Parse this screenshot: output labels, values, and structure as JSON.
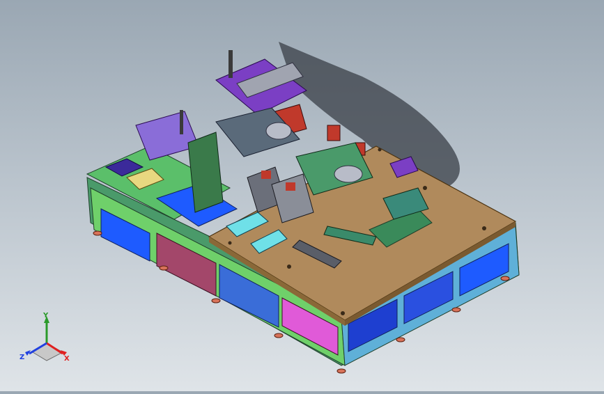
{
  "viewport": {
    "colors": {
      "background_top": "#9aa7b3",
      "background_bottom": "#dfe4e8",
      "table_top": "#b08a5c",
      "frame": "#7ccf5a",
      "panel_blue": "#1e5bff",
      "panel_magenta": "#e05ad8",
      "machine_purple": "#7b3fc4",
      "motor_grey": "#6b6f7a",
      "accent_red": "#c0392b"
    }
  },
  "triad": {
    "x_label": "X",
    "y_label": "Y",
    "z_label": "Z",
    "x_color": "#e02020",
    "y_color": "#2a9a2a",
    "z_color": "#2040e0"
  }
}
